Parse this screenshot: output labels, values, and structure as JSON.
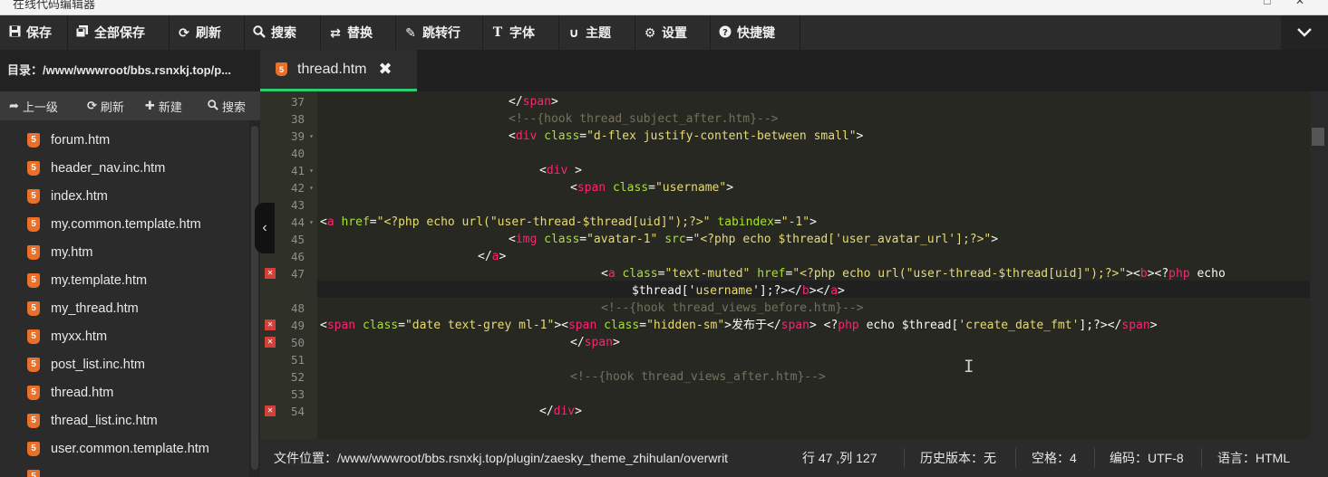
{
  "window": {
    "title_partial": "在线代码编辑器",
    "controls": "□ ✕"
  },
  "toolbar": {
    "items": [
      {
        "label": "保存",
        "icon": "save-icon"
      },
      {
        "label": "全部保存",
        "icon": "save-all-icon"
      },
      {
        "label": "刷新",
        "icon": "refresh-icon"
      },
      {
        "label": "搜索",
        "icon": "search-icon"
      },
      {
        "label": "替换",
        "icon": "replace-icon"
      },
      {
        "label": "跳转行",
        "icon": "pin-icon"
      },
      {
        "label": "字体",
        "icon": "font-icon"
      },
      {
        "label": "主题",
        "icon": "magnet-icon"
      },
      {
        "label": "设置",
        "icon": "gear-icon"
      },
      {
        "label": "快捷键",
        "icon": "question-icon"
      }
    ],
    "collapse_icon": "chevron-down-icon"
  },
  "sidebar": {
    "directory": "目录：/www/wwwroot/bbs.rsnxkj.top/p...",
    "actions": [
      {
        "label": "上一级",
        "icon": "up-arrow-icon"
      },
      {
        "label": "刷新",
        "icon": "refresh-icon"
      },
      {
        "label": "新建",
        "icon": "plus-icon"
      },
      {
        "label": "搜索",
        "icon": "search-icon"
      }
    ],
    "files": [
      "forum.htm",
      "header_nav.inc.htm",
      "index.htm",
      "my.common.template.htm",
      "my.htm",
      "my.template.htm",
      "my_thread.htm",
      "myxx.htm",
      "post_list.inc.htm",
      "thread.htm",
      "thread_list.inc.htm",
      "user.common.template.htm"
    ]
  },
  "tabs": [
    {
      "label": "thread.htm",
      "active": true
    }
  ],
  "editor": {
    "lines": [
      {
        "n": "37",
        "fold": false,
        "err": false
      },
      {
        "n": "38",
        "fold": false,
        "err": false
      },
      {
        "n": "39",
        "fold": true,
        "err": false
      },
      {
        "n": "40",
        "fold": false,
        "err": false
      },
      {
        "n": "41",
        "fold": true,
        "err": false
      },
      {
        "n": "42",
        "fold": true,
        "err": false
      },
      {
        "n": "43",
        "fold": false,
        "err": false
      },
      {
        "n": "44",
        "fold": true,
        "err": false
      },
      {
        "n": "45",
        "fold": false,
        "err": false
      },
      {
        "n": "46",
        "fold": false,
        "err": false
      },
      {
        "n": "47",
        "fold": false,
        "err": true
      },
      {
        "n": "",
        "fold": false,
        "err": false
      },
      {
        "n": "48",
        "fold": false,
        "err": false
      },
      {
        "n": "49",
        "fold": false,
        "err": true
      },
      {
        "n": "50",
        "fold": false,
        "err": true
      },
      {
        "n": "51",
        "fold": false,
        "err": false
      },
      {
        "n": "52",
        "fold": false,
        "err": false
      },
      {
        "n": "53",
        "fold": false,
        "err": false
      },
      {
        "n": "54",
        "fold": false,
        "err": true
      }
    ],
    "code": [
      {
        "indent": 208,
        "tokens": [
          [
            "c-txt",
            "</"
          ],
          [
            "c-tag",
            "span"
          ],
          [
            "c-txt",
            ">"
          ]
        ]
      },
      {
        "indent": 208,
        "tokens": [
          [
            "c-com",
            "<!--{hook thread_subject_after.htm}-->"
          ]
        ]
      },
      {
        "indent": 208,
        "tokens": [
          [
            "c-txt",
            "<"
          ],
          [
            "c-tag",
            "div"
          ],
          [
            "c-txt",
            " "
          ],
          [
            "c-attr",
            "class"
          ],
          [
            "c-txt",
            "="
          ],
          [
            "c-str",
            "\"d-flex justify-content-between small\""
          ],
          [
            "c-txt",
            ">"
          ]
        ]
      },
      {
        "indent": 0,
        "tokens": []
      },
      {
        "indent": 242,
        "tokens": [
          [
            "c-txt",
            "<"
          ],
          [
            "c-tag",
            "div"
          ],
          [
            "c-txt",
            " >"
          ]
        ]
      },
      {
        "indent": 276,
        "tokens": [
          [
            "c-txt",
            "<"
          ],
          [
            "c-tag",
            "span"
          ],
          [
            "c-txt",
            " "
          ],
          [
            "c-attr",
            "class"
          ],
          [
            "c-txt",
            "="
          ],
          [
            "c-str",
            "\"username\""
          ],
          [
            "c-txt",
            ">"
          ]
        ]
      },
      {
        "indent": 0,
        "tokens": []
      },
      {
        "indent": 0,
        "tokens": [
          [
            "c-txt",
            "<"
          ],
          [
            "c-tag",
            "a"
          ],
          [
            "c-txt",
            " "
          ],
          [
            "c-attr",
            "href"
          ],
          [
            "c-txt",
            "="
          ],
          [
            "c-str",
            "\"<?php echo url(\"user-thread-$thread[uid]\");?>\""
          ],
          [
            "c-txt",
            " "
          ],
          [
            "c-attr",
            "tabindex"
          ],
          [
            "c-txt",
            "="
          ],
          [
            "c-str",
            "\"-1\""
          ],
          [
            "c-txt",
            ">"
          ]
        ]
      },
      {
        "indent": 208,
        "tokens": [
          [
            "c-txt",
            "<"
          ],
          [
            "c-tag",
            "img"
          ],
          [
            "c-txt",
            " "
          ],
          [
            "c-attr",
            "class"
          ],
          [
            "c-txt",
            "="
          ],
          [
            "c-str",
            "\"avatar-1\""
          ],
          [
            "c-txt",
            " "
          ],
          [
            "c-attr",
            "src"
          ],
          [
            "c-txt",
            "="
          ],
          [
            "c-str",
            "\"<?php echo $thread['user_avatar_url'];?>\""
          ],
          [
            "c-txt",
            ">"
          ]
        ]
      },
      {
        "indent": 174,
        "tokens": [
          [
            "c-txt",
            "</"
          ],
          [
            "c-tag",
            "a"
          ],
          [
            "c-txt",
            ">"
          ]
        ]
      },
      {
        "indent": 310,
        "tokens": [
          [
            "c-txt",
            "<"
          ],
          [
            "c-tag",
            "a"
          ],
          [
            "c-txt",
            " "
          ],
          [
            "c-attr",
            "class"
          ],
          [
            "c-txt",
            "="
          ],
          [
            "c-str",
            "\"text-muted\""
          ],
          [
            "c-txt",
            " "
          ],
          [
            "c-attr",
            "href"
          ],
          [
            "c-txt",
            "="
          ],
          [
            "c-str",
            "\"<?php echo url(\"user-thread-$thread[uid]\");?>\""
          ],
          [
            "c-txt",
            ">"
          ],
          [
            "c-txt",
            "<"
          ],
          [
            "c-tag",
            "b"
          ],
          [
            "c-txt",
            ">"
          ],
          [
            "c-txt",
            "<?"
          ],
          [
            "c-tag",
            "php"
          ],
          [
            "c-txt",
            " echo"
          ]
        ]
      },
      {
        "indent": 344,
        "tokens": [
          [
            "c-txt",
            "$thread['"
          ],
          [
            "c-str",
            "username"
          ],
          [
            "c-txt",
            "'];?>"
          ],
          [
            "c-txt",
            "</"
          ],
          [
            "c-tag",
            "b"
          ],
          [
            "c-txt",
            "></"
          ],
          [
            "c-tag",
            "a"
          ],
          [
            "c-txt",
            ">"
          ]
        ]
      },
      {
        "indent": 310,
        "tokens": [
          [
            "c-com",
            "<!--{hook thread_views_before.htm}-->"
          ]
        ]
      },
      {
        "indent": 0,
        "tokens": [
          [
            "c-txt",
            "<"
          ],
          [
            "c-tag",
            "span"
          ],
          [
            "c-txt",
            " "
          ],
          [
            "c-attr",
            "class"
          ],
          [
            "c-txt",
            "="
          ],
          [
            "c-str",
            "\"date text-grey ml-1\""
          ],
          [
            "c-txt",
            ">"
          ],
          [
            "c-txt",
            "<"
          ],
          [
            "c-tag",
            "span"
          ],
          [
            "c-txt",
            " "
          ],
          [
            "c-attr",
            "class"
          ],
          [
            "c-txt",
            "="
          ],
          [
            "c-str",
            "\"hidden-sm\""
          ],
          [
            "c-txt",
            ">发布于</"
          ],
          [
            "c-tag",
            "span"
          ],
          [
            "c-txt",
            "> <?"
          ],
          [
            "c-tag",
            "php"
          ],
          [
            "c-txt",
            " echo $thread["
          ],
          [
            "c-str",
            "'create_date_fmt'"
          ],
          [
            "c-txt",
            "];?></"
          ],
          [
            "c-tag",
            "span"
          ],
          [
            "c-txt",
            ">"
          ]
        ]
      },
      {
        "indent": 276,
        "tokens": [
          [
            "c-txt",
            "</"
          ],
          [
            "c-tag",
            "span"
          ],
          [
            "c-txt",
            ">"
          ]
        ]
      },
      {
        "indent": 0,
        "tokens": []
      },
      {
        "indent": 276,
        "tokens": [
          [
            "c-com",
            "<!--{hook thread_views_after.htm}-->"
          ]
        ]
      },
      {
        "indent": 0,
        "tokens": []
      },
      {
        "indent": 242,
        "tokens": [
          [
            "c-txt",
            "</"
          ],
          [
            "c-tag",
            "div"
          ],
          [
            "c-txt",
            ">"
          ]
        ]
      }
    ]
  },
  "statusbar": {
    "file_path": "文件位置：/www/wwwroot/bbs.rsnxkj.top/plugin/zaesky_theme_zhihulan/overwrit",
    "position": "行 47 ,列 127",
    "history": "历史版本：无",
    "spaces": "空格：4",
    "encoding": "编码：UTF-8",
    "language": "语言：HTML"
  }
}
